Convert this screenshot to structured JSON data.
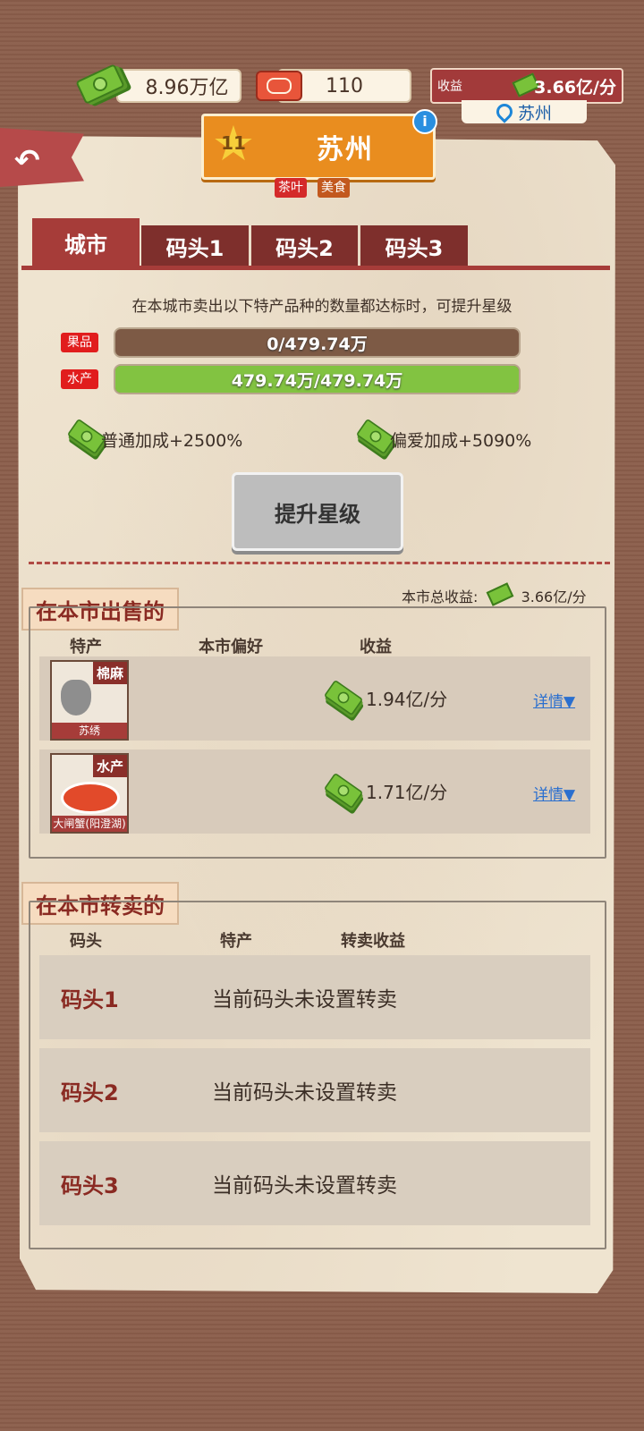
{
  "topbar": {
    "money": "8.96万亿",
    "tickets": "110",
    "income_label": "收益",
    "income_value": "3.66亿/分",
    "location": "苏州"
  },
  "city": {
    "star_level": "11",
    "name": "苏州",
    "tags": [
      "茶叶",
      "美食"
    ]
  },
  "tabs": [
    {
      "label": "城市",
      "active": true
    },
    {
      "label": "码头1",
      "active": false
    },
    {
      "label": "码头2",
      "active": false
    },
    {
      "label": "码头3",
      "active": false
    }
  ],
  "upgrade": {
    "hint": "在本城市卖出以下特产品种的数量都达标时，可提升星级",
    "requirements": [
      {
        "category": "果品",
        "progress_text": "0/479.74万",
        "progress_fraction": 0.0
      },
      {
        "category": "水产",
        "progress_text": "479.74万/479.74万",
        "progress_fraction": 1.0
      }
    ],
    "normal_bonus": "普通加成+2500%",
    "favor_bonus": "偏爱加成+5090%",
    "button_label": "提升星级"
  },
  "selling": {
    "title": "在本市出售的",
    "total_label": "本市总收益:",
    "total_value": "3.66亿/分",
    "columns": [
      "特产",
      "本市偏好",
      "收益"
    ],
    "items": [
      {
        "category": "棉麻",
        "name": "苏绣",
        "income": "1.94亿/分",
        "detail": "详情▼"
      },
      {
        "category": "水产",
        "name": "大闸蟹(阳澄湖)",
        "income": "1.71亿/分",
        "detail": "详情▼"
      }
    ]
  },
  "resale": {
    "title": "在本市转卖的",
    "columns": [
      "码头",
      "特产",
      "转卖收益"
    ],
    "rows": [
      {
        "dock": "码头1",
        "message": "当前码头未设置转卖"
      },
      {
        "dock": "码头2",
        "message": "当前码头未设置转卖"
      },
      {
        "dock": "码头3",
        "message": "当前码头未设置转卖"
      }
    ]
  },
  "colors": {
    "accent_red": "#a63c39",
    "progress_green": "#82c341",
    "banner_orange": "#e98d1f",
    "link_blue": "#2a6fcf"
  }
}
